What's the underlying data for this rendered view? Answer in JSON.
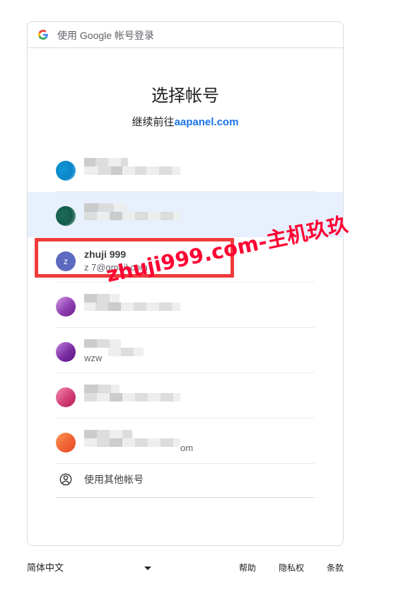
{
  "header": {
    "text": "使用 Google 帐号登录"
  },
  "title": "选择帐号",
  "subtitle": {
    "prefix": "继续前往",
    "link": "aapanel.com"
  },
  "accounts": [
    {
      "display": "",
      "visible_text": "",
      "style": "blur-1"
    },
    {
      "display": "",
      "visible_text": "",
      "style": "blur-2",
      "selected": true
    },
    {
      "name": "zhuji 999",
      "email": "z          7@gmail.com",
      "avatar_letter": "z",
      "style": "letter"
    },
    {
      "display": "",
      "visible_text": "",
      "style": "blur-3"
    },
    {
      "display": "",
      "visible_text": "wzw",
      "style": "blur-4"
    },
    {
      "display": "",
      "visible_text": "",
      "style": "blur-5"
    },
    {
      "display": "",
      "visible_text": "om",
      "style": "blur-6"
    }
  ],
  "other_account": {
    "label": "使用其他帐号",
    "icon": "person-circle-icon"
  },
  "footer": {
    "language": "简体中文",
    "help": "帮助",
    "privacy": "隐私权",
    "terms": "条款"
  },
  "annotation": {
    "watermark": "zhuji999.com-主机玖玖",
    "highlight_color": "#ef3b3b"
  },
  "colors": {
    "link": "#1a73e8",
    "selected_row": "#e8f0fe",
    "avatar_z": "#5c6bc0",
    "border": "#dadce0",
    "watermark": "#ff0033"
  }
}
